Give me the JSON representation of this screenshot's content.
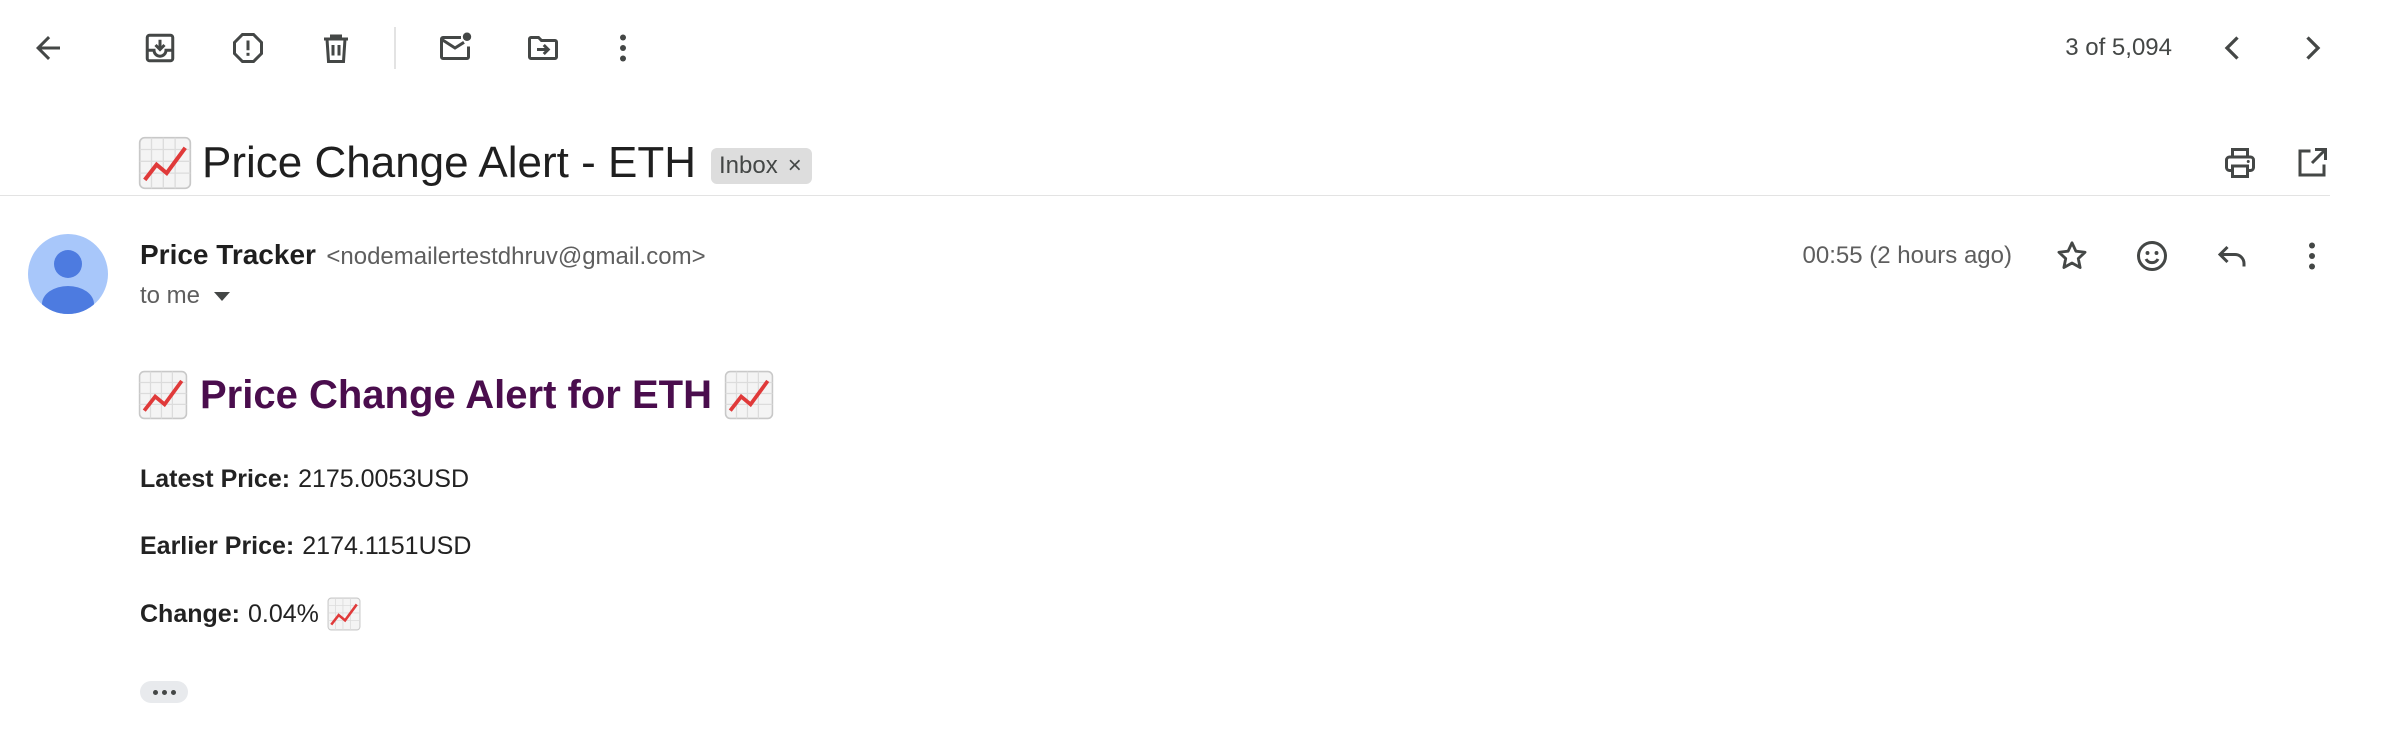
{
  "toolbar": {
    "back_icon": "arrow-left-icon",
    "archive_icon": "archive-icon",
    "spam_icon": "report-spam-icon",
    "delete_icon": "trash-icon",
    "mark_unread_icon": "mark-unread-icon",
    "move_icon": "move-to-folder-icon",
    "more_icon": "more-vertical-icon",
    "pager_text": "3 of 5,094",
    "prev_icon": "chevron-left-icon",
    "next_icon": "chevron-right-icon"
  },
  "subject": {
    "emoji": "chart-increasing-emoji",
    "text": "Price Change Alert - ETH",
    "label": "Inbox",
    "label_remove": "×",
    "print_icon": "print-icon",
    "open_new_window_icon": "open-in-new-icon"
  },
  "message": {
    "sender_name": "Price Tracker",
    "sender_email": "<nodemailertestdhruv@gmail.com>",
    "recipient_text": "to me",
    "timestamp": "00:55 (2 hours ago)",
    "star_icon": "star-icon",
    "emoji_reaction_icon": "emoji-icon",
    "reply_icon": "reply-icon",
    "more_icon": "more-vertical-icon"
  },
  "body": {
    "heading": "Price Change Alert for ETH",
    "latest_label": "Latest Price:",
    "latest_value": "2175.0053USD",
    "earlier_label": "Earlier Price:",
    "earlier_value": "2174.1151USD",
    "change_label": "Change:",
    "change_value": "0.04%"
  },
  "colors": {
    "heading": "#4a0d4d",
    "avatar_bg": "#a8c7fa",
    "avatar_fg": "#4d7be0",
    "chip_bg": "#dddddd",
    "icon": "#444746"
  }
}
